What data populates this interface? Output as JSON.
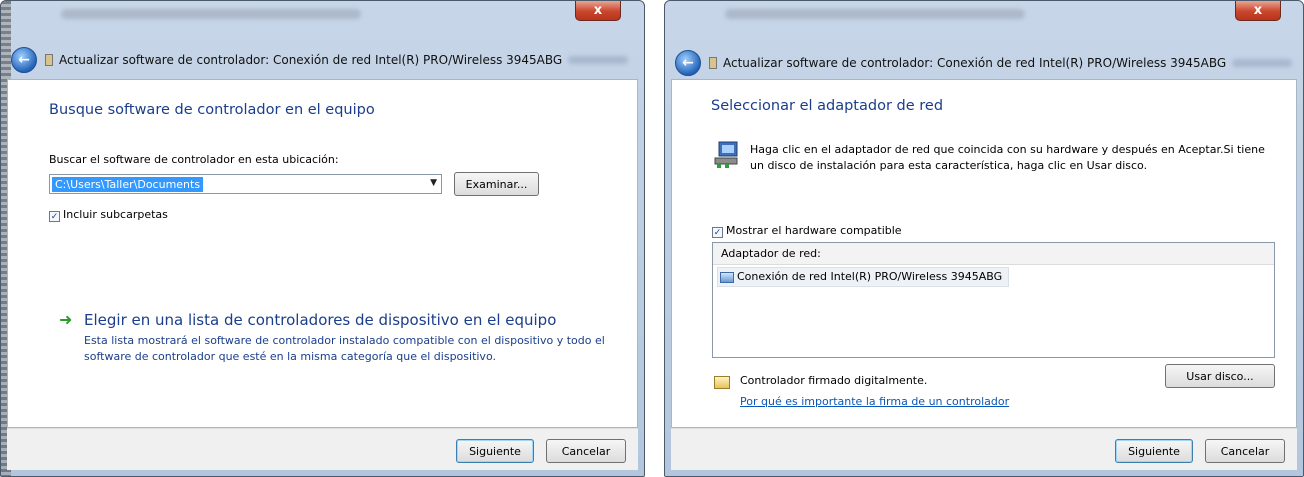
{
  "dialog1": {
    "close_label": "x",
    "nav_title": "Actualizar software de controlador: Conexión de red Intel(R) PRO/Wireless 3945ABG",
    "heading": "Busque software de controlador en el equipo",
    "search_label": "Buscar el software de controlador en esta ubicación:",
    "path_value": "C:\\Users\\Taller\\Documents",
    "browse_button": "Examinar...",
    "include_subfolders": "Incluir subcarpetas",
    "choose_link_title": "Elegir en una lista de controladores de dispositivo en el equipo",
    "choose_link_desc": "Esta lista mostrará el software de controlador instalado compatible con el dispositivo y todo el software de controlador que esté en la misma categoría que el dispositivo.",
    "next_button": "Siguiente",
    "cancel_button": "Cancelar"
  },
  "dialog2": {
    "close_label": "x",
    "nav_title": "Actualizar software de controlador: Conexión de red Intel(R) PRO/Wireless 3945ABG",
    "heading": "Seleccionar el adaptador de red",
    "instructions": "Haga clic en el adaptador de red que coincida con su hardware y después en Aceptar.Si tiene un disco de instalación para esta característica, haga clic en Usar disco.",
    "show_compatible": "Mostrar el hardware compatible",
    "list_header": "Adaptador de red:",
    "list_items": [
      "Conexión de red Intel(R) PRO/Wireless 3945ABG"
    ],
    "signed_text": "Controlador firmado digitalmente.",
    "have_disk_button": "Usar disco...",
    "why_link": "Por qué es importante la firma de un controlador",
    "next_button": "Siguiente",
    "cancel_button": "Cancelar"
  },
  "colors": {
    "heading_blue": "#1a3e8c",
    "link_blue": "#0a57b8",
    "selection_blue": "#3399ff",
    "close_red": "#c9452c"
  },
  "icons": {
    "back": "back-arrow-icon",
    "close": "close-icon",
    "green_arrow": "green-arrow-icon",
    "network_adapter": "network-adapter-icon",
    "signed_driver": "signed-driver-icon"
  }
}
